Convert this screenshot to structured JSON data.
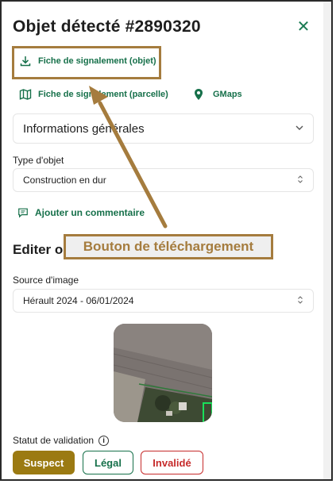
{
  "panel": {
    "title": "Objet détecté #2890320",
    "close_glyph": "✕"
  },
  "links": {
    "fiche_objet": "Fiche de signalement (objet)",
    "fiche_parcelle": "Fiche de signalement (parcelle)",
    "gmaps": "GMaps",
    "ajouter_commentaire": "Ajouter un commentaire"
  },
  "accordion": {
    "label": "Informations générales"
  },
  "type_objet": {
    "label": "Type d'objet",
    "value": "Construction en dur"
  },
  "edit_section": {
    "title": "Editer o"
  },
  "source_image": {
    "label": "Source d'image",
    "value": "Hérault 2024 - 06/01/2024"
  },
  "validation": {
    "label": "Statut de validation",
    "info_glyph": "i",
    "buttons": [
      "Suspect",
      "Légal",
      "Invalidé"
    ]
  },
  "annotation": {
    "label": "Bouton de téléchargement"
  },
  "icons": {
    "download": "download-icon",
    "map": "map-icon",
    "location": "location-pin-icon",
    "comment": "comment-icon",
    "chevron": "chevron-down-icon",
    "updown": "updown-chevron-icon",
    "info": "info-icon",
    "close": "close-icon"
  },
  "colors": {
    "brand_green": "#16704a",
    "annotation_brown": "#a57c3e",
    "suspect_fill": "#9b7a12",
    "invalide_red": "#c62b2b"
  }
}
